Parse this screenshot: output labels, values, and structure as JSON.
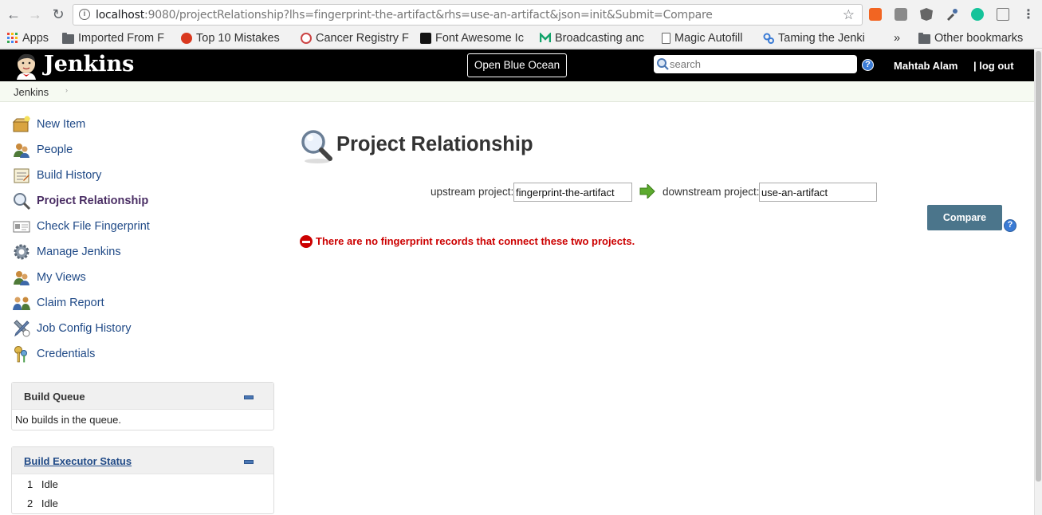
{
  "browser": {
    "url_host": "localhost",
    "url_rest": ":9080/projectRelationship?lhs=fingerprint-the-artifact&rhs=use-an-artifact&json=init&Submit=Compare",
    "bookmarks": [
      {
        "label": "Apps",
        "icon": "apps-grid-icon"
      },
      {
        "label": "Imported From F",
        "icon": "folder-icon"
      },
      {
        "label": "Top 10 Mistakes",
        "icon": "opera-icon"
      },
      {
        "label": "Cancer Registry F",
        "icon": "registry-icon"
      },
      {
        "label": "Font Awesome Ic",
        "icon": "flag-icon"
      },
      {
        "label": "Broadcasting anc",
        "icon": "m-logo-icon"
      },
      {
        "label": "Magic Autofill",
        "icon": "page-icon"
      },
      {
        "label": "Taming the Jenki",
        "icon": "link-icon"
      }
    ],
    "more_label": "»",
    "other_bookmarks": "Other bookmarks"
  },
  "header": {
    "brand": "Jenkins",
    "blue_ocean_label": "Open Blue Ocean",
    "search_placeholder": "search",
    "help_label": "?",
    "user_name": "Mahtab Alam",
    "logout_label": "| log out"
  },
  "breadcrumb": {
    "items": [
      "Jenkins"
    ],
    "separator": "›"
  },
  "sidebar": {
    "tasks": [
      {
        "label": "New Item",
        "icon": "new-item-icon"
      },
      {
        "label": "People",
        "icon": "people-icon"
      },
      {
        "label": "Build History",
        "icon": "build-history-icon"
      },
      {
        "label": "Project Relationship",
        "icon": "magnifier-icon",
        "active": true
      },
      {
        "label": "Check File Fingerprint",
        "icon": "fingerprint-icon"
      },
      {
        "label": "Manage Jenkins",
        "icon": "gear-icon"
      },
      {
        "label": "My Views",
        "icon": "user-views-icon"
      },
      {
        "label": "Claim Report",
        "icon": "claim-icon"
      },
      {
        "label": "Job Config History",
        "icon": "tools-icon"
      },
      {
        "label": "Credentials",
        "icon": "keys-icon"
      }
    ],
    "build_queue": {
      "title": "Build Queue",
      "empty_text": "No builds in the queue."
    },
    "executor_status": {
      "title": "Build Executor Status",
      "executors": [
        {
          "number": "1",
          "state": "Idle"
        },
        {
          "number": "2",
          "state": "Idle"
        }
      ]
    }
  },
  "main": {
    "title": "Project Relationship",
    "upstream_label": "upstream project:",
    "upstream_value": "fingerprint-the-artifact",
    "downstream_label": "downstream project:",
    "downstream_value": "use-an-artifact",
    "compare_label": "Compare",
    "error_message": "There are no fingerprint records that connect these two projects."
  },
  "colors": {
    "header_bg": "#000000",
    "link": "#204a87",
    "error": "#cc0000",
    "button": "#4b758b"
  }
}
